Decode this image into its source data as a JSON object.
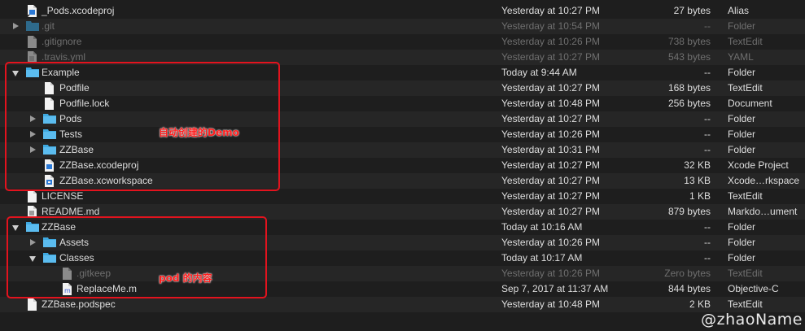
{
  "rows": [
    {
      "name": "_Pods.xcodeproj",
      "date": "Yesterday at 10:27 PM",
      "size": "27 bytes",
      "kind": "Alias"
    },
    {
      "name": ".git",
      "date": "Yesterday at 10:54 PM",
      "size": "--",
      "kind": "Folder"
    },
    {
      "name": ".gitignore",
      "date": "Yesterday at 10:26 PM",
      "size": "738 bytes",
      "kind": "TextEdit"
    },
    {
      "name": ".travis.yml",
      "date": "Yesterday at 10:27 PM",
      "size": "543 bytes",
      "kind": "YAML"
    },
    {
      "name": "Example",
      "date": "Today at 9:44 AM",
      "size": "--",
      "kind": "Folder"
    },
    {
      "name": "Podfile",
      "date": "Yesterday at 10:27 PM",
      "size": "168 bytes",
      "kind": "TextEdit"
    },
    {
      "name": "Podfile.lock",
      "date": "Yesterday at 10:48 PM",
      "size": "256 bytes",
      "kind": "Document"
    },
    {
      "name": "Pods",
      "date": "Yesterday at 10:27 PM",
      "size": "--",
      "kind": "Folder"
    },
    {
      "name": "Tests",
      "date": "Yesterday at 10:26 PM",
      "size": "--",
      "kind": "Folder"
    },
    {
      "name": "ZZBase",
      "date": "Yesterday at 10:31 PM",
      "size": "--",
      "kind": "Folder"
    },
    {
      "name": "ZZBase.xcodeproj",
      "date": "Yesterday at 10:27 PM",
      "size": "32 KB",
      "kind": "Xcode Project"
    },
    {
      "name": "ZZBase.xcworkspace",
      "date": "Yesterday at 10:27 PM",
      "size": "13 KB",
      "kind": "Xcode…rkspace"
    },
    {
      "name": "LICENSE",
      "date": "Yesterday at 10:27 PM",
      "size": "1 KB",
      "kind": "TextEdit"
    },
    {
      "name": "README.md",
      "date": "Yesterday at 10:27 PM",
      "size": "879 bytes",
      "kind": "Markdo…ument"
    },
    {
      "name": "ZZBase",
      "date": "Today at 10:16 AM",
      "size": "--",
      "kind": "Folder"
    },
    {
      "name": "Assets",
      "date": "Yesterday at 10:26 PM",
      "size": "--",
      "kind": "Folder"
    },
    {
      "name": "Classes",
      "date": "Today at 10:17 AM",
      "size": "--",
      "kind": "Folder"
    },
    {
      "name": ".gitkeep",
      "date": "Yesterday at 10:26 PM",
      "size": "Zero bytes",
      "kind": "TextEdit"
    },
    {
      "name": "ReplaceMe.m",
      "date": "Sep 7, 2017 at 11:37 AM",
      "size": "844 bytes",
      "kind": "Objective-C"
    },
    {
      "name": "ZZBase.podspec",
      "date": "Yesterday at 10:48 PM",
      "size": "2 KB",
      "kind": "TextEdit"
    }
  ],
  "annotations": {
    "example_note": "自动创建的Demo",
    "pod_note": "pod 的内容"
  },
  "watermark": "@zhaoName",
  "colors": {
    "folder": "#3fa9e0",
    "annotation": "#e3131e",
    "background": "#1e1e1e"
  }
}
